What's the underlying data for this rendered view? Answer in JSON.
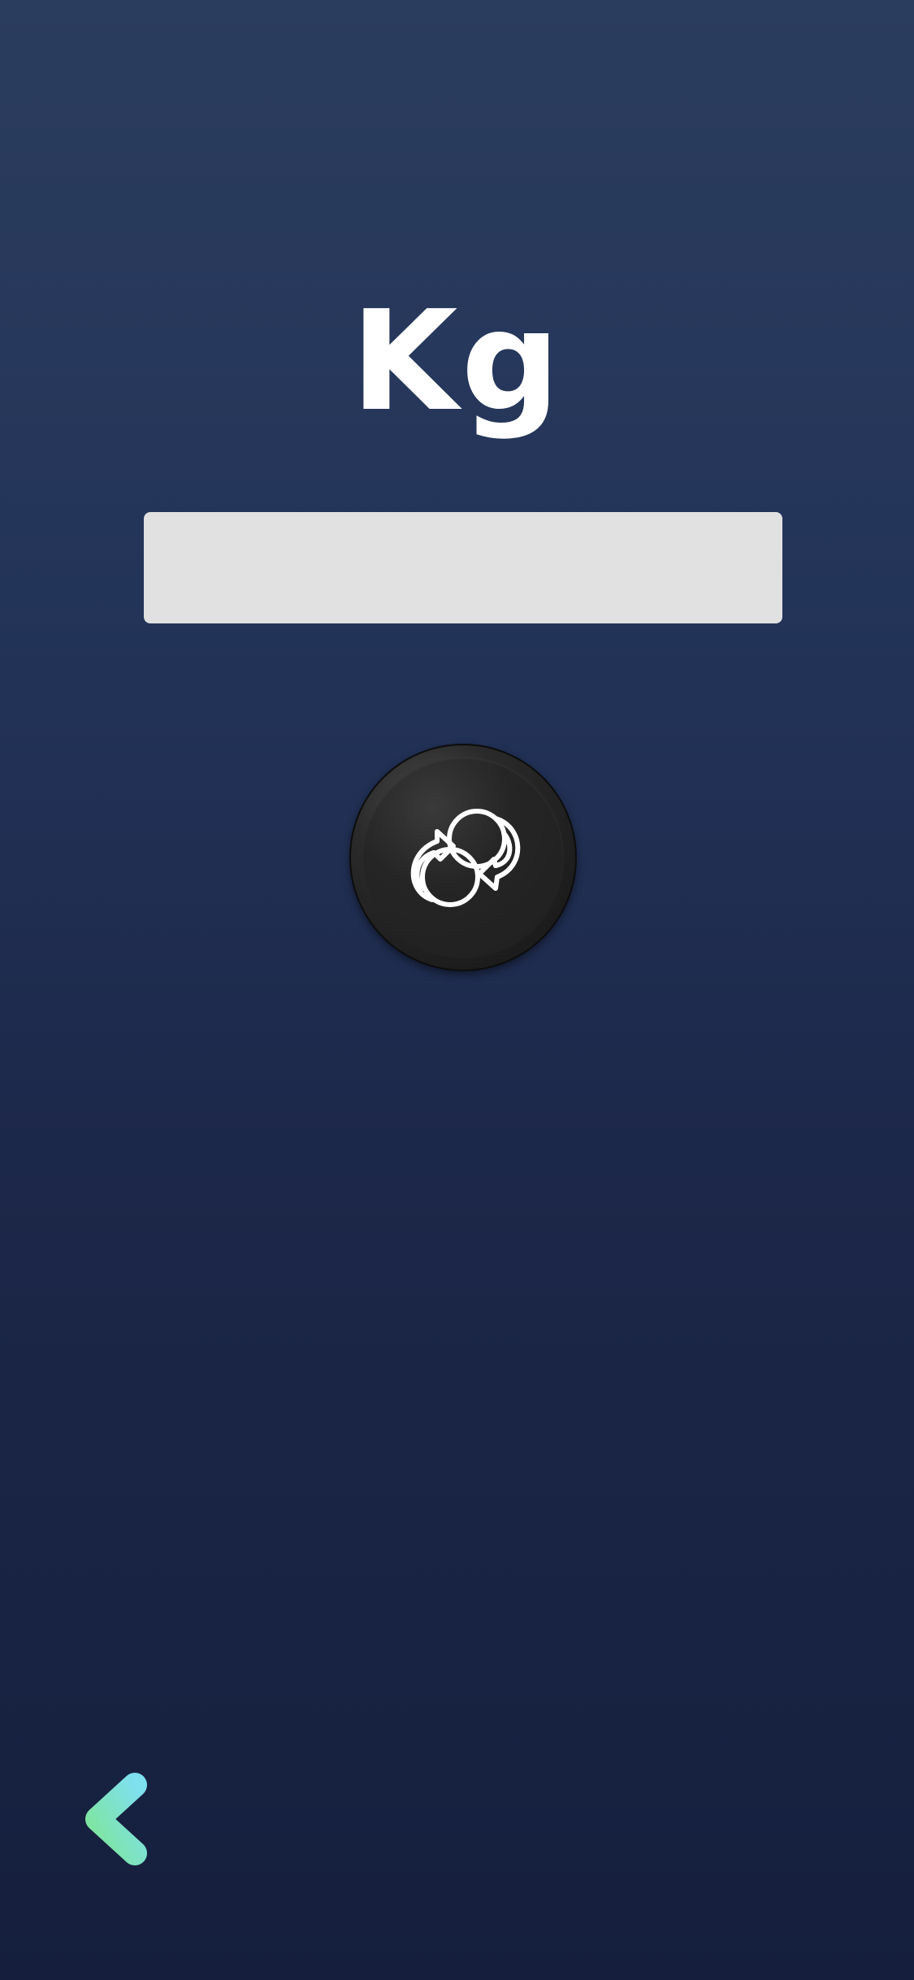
{
  "header": {
    "unit_label": "Kg"
  },
  "input": {
    "value": "",
    "placeholder": ""
  },
  "convert_button": {
    "icon": "currency-exchange-icon"
  },
  "back_button": {
    "icon": "arrow-left-icon",
    "gradient_start": "#7ee59a",
    "gradient_end": "#7fe0ee"
  },
  "colors": {
    "background_top": "#2b3d5e",
    "background_bottom": "#151f3d",
    "input_fill": "#e1e1e1",
    "button_fill": "#1f1f1f"
  }
}
